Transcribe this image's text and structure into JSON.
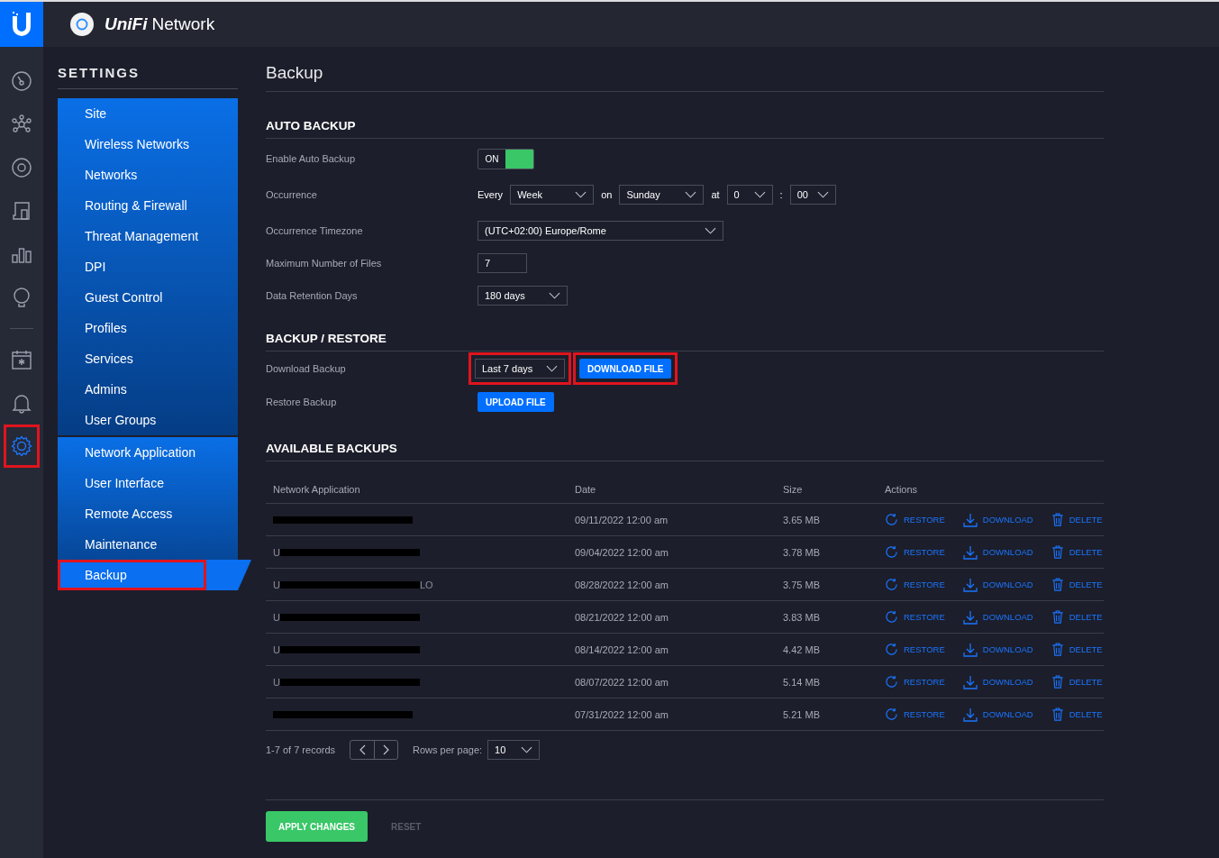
{
  "app": {
    "brand_italic": "UniFi",
    "brand": "Network"
  },
  "rail": [
    {
      "selected": false,
      "highlighted": false
    },
    {
      "selected": false,
      "highlighted": false
    },
    {
      "selected": false,
      "highlighted": false
    },
    {
      "selected": false,
      "highlighted": false
    },
    {
      "selected": false,
      "highlighted": false
    },
    {
      "selected": false,
      "highlighted": false
    },
    {
      "selected": false,
      "highlighted": false
    },
    {
      "selected": false,
      "highlighted": false
    },
    {
      "selected": true,
      "highlighted": true
    }
  ],
  "settings": {
    "title": "SETTINGS",
    "groups": [
      [
        {
          "label": "Site",
          "selected": false,
          "highlighted": false
        },
        {
          "label": "Wireless Networks",
          "selected": false,
          "highlighted": false
        },
        {
          "label": "Networks",
          "selected": false,
          "highlighted": false
        },
        {
          "label": "Routing & Firewall",
          "selected": false,
          "highlighted": false
        },
        {
          "label": "Threat Management",
          "selected": false,
          "highlighted": false
        },
        {
          "label": "DPI",
          "selected": false,
          "highlighted": false
        },
        {
          "label": "Guest Control",
          "selected": false,
          "highlighted": false
        },
        {
          "label": "Profiles",
          "selected": false,
          "highlighted": false
        },
        {
          "label": "Services",
          "selected": false,
          "highlighted": false
        },
        {
          "label": "Admins",
          "selected": false,
          "highlighted": false
        },
        {
          "label": "User Groups",
          "selected": false,
          "highlighted": false
        }
      ],
      [
        {
          "label": "Network Application",
          "selected": false,
          "highlighted": false
        },
        {
          "label": "User Interface",
          "selected": false,
          "highlighted": false
        },
        {
          "label": "Remote Access",
          "selected": false,
          "highlighted": false
        },
        {
          "label": "Maintenance",
          "selected": false,
          "highlighted": false
        },
        {
          "label": "Backup",
          "selected": true,
          "highlighted": true
        }
      ]
    ]
  },
  "page_title": "Backup",
  "auto_backup": {
    "heading": "AUTO BACKUP",
    "enable": {
      "label": "Enable Auto Backup",
      "toggle_text": "ON",
      "on": true
    },
    "occurrence": {
      "label": "Occurrence",
      "every": "Every",
      "frequency": "Week",
      "on": "on",
      "day": "Sunday",
      "at": "at",
      "hour": "0",
      "colon": ":",
      "minute": "00"
    },
    "timezone": {
      "label": "Occurrence Timezone",
      "value": "(UTC+02:00) Europe/Rome"
    },
    "max_files": {
      "label": "Maximum Number of Files",
      "value": "7"
    },
    "retention": {
      "label": "Data Retention Days",
      "value": "180 days"
    }
  },
  "backup_restore": {
    "heading": "BACKUP / RESTORE",
    "download": {
      "label": "Download Backup",
      "range": "Last 7 days",
      "range_highlighted": true,
      "button": "DOWNLOAD FILE",
      "button_highlighted": true
    },
    "restore": {
      "label": "Restore Backup",
      "button": "UPLOAD FILE"
    }
  },
  "available_backups": {
    "heading": "AVAILABLE BACKUPS",
    "columns": [
      "Network Application",
      "Date",
      "Size",
      "Actions"
    ],
    "rows": [
      {
        "name_start": "",
        "name_end": "",
        "date": "09/11/2022 12:00 am",
        "size": "3.65 MB",
        "actions": [
          "RESTORE",
          "DOWNLOAD",
          "DELETE"
        ]
      },
      {
        "name_start": "U",
        "name_end": "",
        "date": "09/04/2022 12:00 am",
        "size": "3.78 MB",
        "actions": [
          "RESTORE",
          "DOWNLOAD",
          "DELETE"
        ]
      },
      {
        "name_start": "U",
        "name_end": "LO",
        "date": "08/28/2022 12:00 am",
        "size": "3.75 MB",
        "actions": [
          "RESTORE",
          "DOWNLOAD",
          "DELETE"
        ]
      },
      {
        "name_start": "U",
        "name_end": "",
        "date": "08/21/2022 12:00 am",
        "size": "3.83 MB",
        "actions": [
          "RESTORE",
          "DOWNLOAD",
          "DELETE"
        ]
      },
      {
        "name_start": "U",
        "name_end": "",
        "date": "08/14/2022 12:00 am",
        "size": "4.42 MB",
        "actions": [
          "RESTORE",
          "DOWNLOAD",
          "DELETE"
        ]
      },
      {
        "name_start": "U",
        "name_end": "",
        "date": "08/07/2022 12:00 am",
        "size": "5.14 MB",
        "actions": [
          "RESTORE",
          "DOWNLOAD",
          "DELETE"
        ]
      },
      {
        "name_start": "",
        "name_end": "",
        "date": "07/31/2022 12:00 am",
        "size": "5.21 MB",
        "actions": [
          "RESTORE",
          "DOWNLOAD",
          "DELETE"
        ]
      }
    ],
    "records": "1-7 of 7 records",
    "rows_per_page_label": "Rows per page:",
    "rows_per_page": "10"
  },
  "footer": {
    "apply": "APPLY CHANGES",
    "reset": "RESET"
  }
}
